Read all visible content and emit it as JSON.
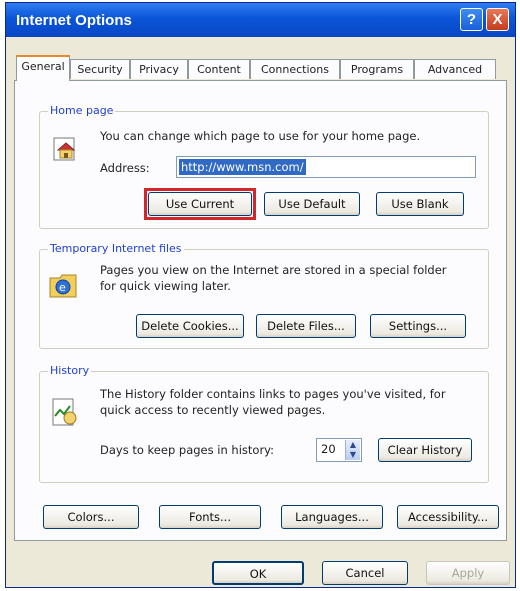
{
  "window": {
    "title": "Internet Options",
    "help_glyph": "?",
    "close_glyph": "X"
  },
  "tabs": [
    {
      "label": "General",
      "active": true
    },
    {
      "label": "Security"
    },
    {
      "label": "Privacy"
    },
    {
      "label": "Content"
    },
    {
      "label": "Connections"
    },
    {
      "label": "Programs"
    },
    {
      "label": "Advanced"
    }
  ],
  "home_page": {
    "legend": "Home page",
    "description": "You can change which page to use for your home page.",
    "address_label": "Address:",
    "address_value": "http://www.msn.com/",
    "use_current": "Use Current",
    "use_default": "Use Default",
    "use_blank": "Use Blank"
  },
  "temp_files": {
    "legend": "Temporary Internet files",
    "description_line1": "Pages you view on the Internet are stored in a special folder",
    "description_line2": "for quick viewing later.",
    "delete_cookies": "Delete Cookies...",
    "delete_files": "Delete Files...",
    "settings": "Settings..."
  },
  "history": {
    "legend": "History",
    "description_line1": "The History folder contains links to pages you've visited, for",
    "description_line2": "quick access to recently viewed pages.",
    "days_label": "Days to keep pages in history:",
    "days_value": "20",
    "clear_history": "Clear History"
  },
  "bottom_buttons": {
    "colors": "Colors...",
    "fonts": "Fonts...",
    "languages": "Languages...",
    "accessibility": "Accessibility..."
  },
  "dialog_buttons": {
    "ok": "OK",
    "cancel": "Cancel",
    "apply": "Apply"
  },
  "colors": {
    "title_bar": "#0a56d8",
    "highlight": "#d3252c",
    "legend_text": "#1f3fcf",
    "active_tab_accent": "#e68b2c"
  }
}
